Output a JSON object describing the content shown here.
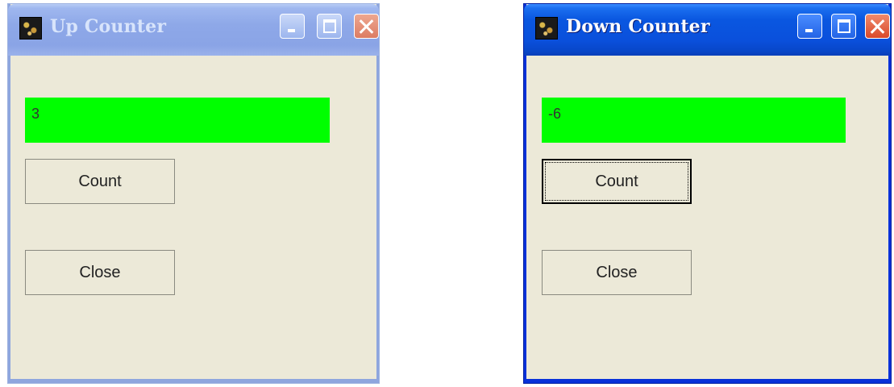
{
  "windows": [
    {
      "title": "Up Counter",
      "icon": "app-icon",
      "state": "inactive",
      "counter_value": "3",
      "count_label": "Count",
      "close_label": "Close",
      "field_color": "#00ff00"
    },
    {
      "title": "Down Counter",
      "icon": "app-icon",
      "state": "active",
      "counter_value": "-6",
      "count_label": "Count",
      "close_label": "Close",
      "field_color": "#00ff00"
    }
  ]
}
